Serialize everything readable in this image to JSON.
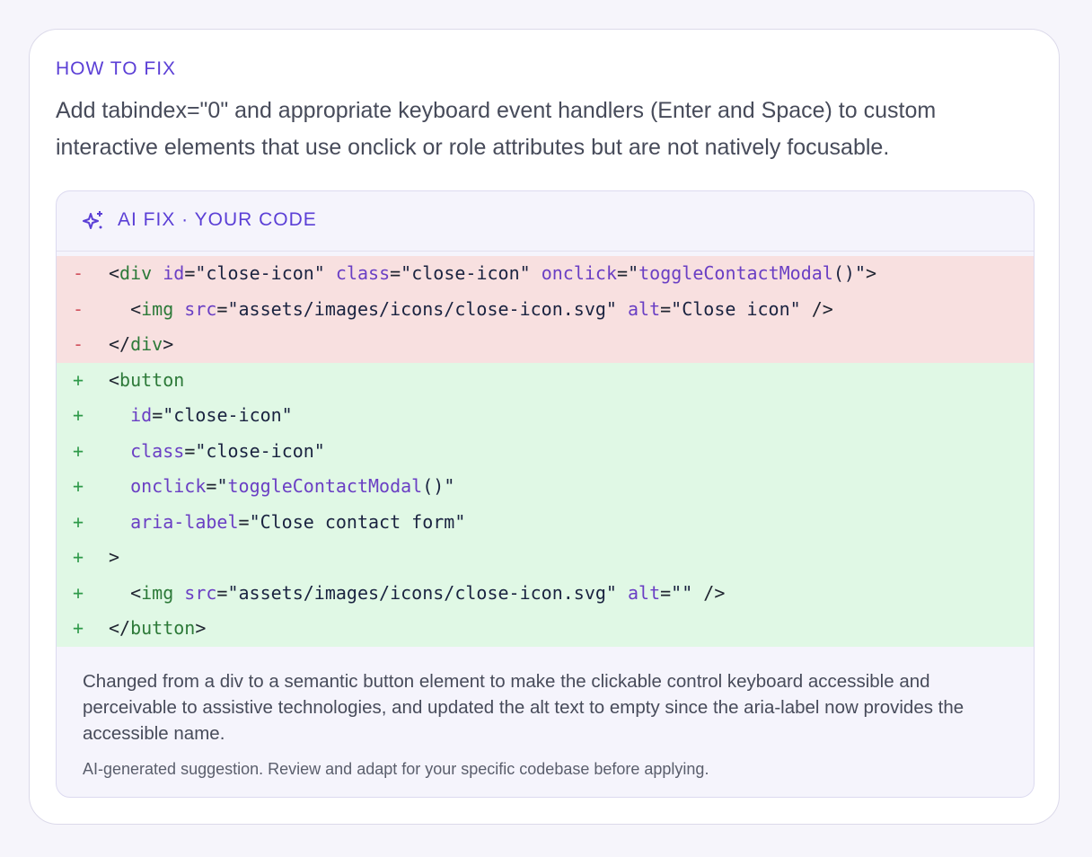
{
  "how_to_fix": {
    "title": "HOW TO FIX",
    "description": "Add tabindex=\"0\" and appropriate keyboard event handlers (Enter and Space) to custom interactive elements that use onclick or role attributes but are not natively focusable."
  },
  "ai_fix": {
    "label": "AI FIX · YOUR CODE",
    "icon": "sparkles-icon",
    "diff_lines": [
      {
        "type": "del",
        "marker": "-",
        "tokens": [
          [
            "p",
            "<"
          ],
          [
            "t",
            "div"
          ],
          [
            "p",
            " "
          ],
          [
            "a",
            "id"
          ],
          [
            "p",
            "="
          ],
          [
            "s",
            "\"close-icon\""
          ],
          [
            "p",
            " "
          ],
          [
            "a",
            "class"
          ],
          [
            "p",
            "="
          ],
          [
            "s",
            "\"close-icon\""
          ],
          [
            "p",
            " "
          ],
          [
            "a",
            "onclick"
          ],
          [
            "p",
            "="
          ],
          [
            "s",
            "\""
          ],
          [
            "a",
            "toggleContactModal"
          ],
          [
            "s",
            "()\""
          ],
          [
            "p",
            ">"
          ]
        ]
      },
      {
        "type": "del",
        "marker": "-",
        "tokens": [
          [
            "p",
            "  <"
          ],
          [
            "t",
            "img"
          ],
          [
            "p",
            " "
          ],
          [
            "a",
            "src"
          ],
          [
            "p",
            "="
          ],
          [
            "s",
            "\"assets/images/icons/close-icon.svg\""
          ],
          [
            "p",
            " "
          ],
          [
            "a",
            "alt"
          ],
          [
            "p",
            "="
          ],
          [
            "s",
            "\"Close icon\""
          ],
          [
            "p",
            " />"
          ]
        ]
      },
      {
        "type": "del",
        "marker": "-",
        "tokens": [
          [
            "p",
            "</"
          ],
          [
            "t",
            "div"
          ],
          [
            "p",
            ">"
          ]
        ]
      },
      {
        "type": "add",
        "marker": "+",
        "tokens": [
          [
            "p",
            "<"
          ],
          [
            "t",
            "button"
          ]
        ]
      },
      {
        "type": "add",
        "marker": "+",
        "tokens": [
          [
            "p",
            "  "
          ],
          [
            "a",
            "id"
          ],
          [
            "p",
            "="
          ],
          [
            "s",
            "\"close-icon\""
          ]
        ]
      },
      {
        "type": "add",
        "marker": "+",
        "tokens": [
          [
            "p",
            "  "
          ],
          [
            "a",
            "class"
          ],
          [
            "p",
            "="
          ],
          [
            "s",
            "\"close-icon\""
          ]
        ]
      },
      {
        "type": "add",
        "marker": "+",
        "tokens": [
          [
            "p",
            "  "
          ],
          [
            "a",
            "onclick"
          ],
          [
            "p",
            "="
          ],
          [
            "s",
            "\""
          ],
          [
            "a",
            "toggleContactModal"
          ],
          [
            "s",
            "()\""
          ]
        ]
      },
      {
        "type": "add",
        "marker": "+",
        "tokens": [
          [
            "p",
            "  "
          ],
          [
            "a",
            "aria-label"
          ],
          [
            "p",
            "="
          ],
          [
            "s",
            "\"Close contact form\""
          ]
        ]
      },
      {
        "type": "add",
        "marker": "+",
        "tokens": [
          [
            "p",
            ">"
          ]
        ]
      },
      {
        "type": "add",
        "marker": "+",
        "tokens": [
          [
            "p",
            "  <"
          ],
          [
            "t",
            "img"
          ],
          [
            "p",
            " "
          ],
          [
            "a",
            "src"
          ],
          [
            "p",
            "="
          ],
          [
            "s",
            "\"assets/images/icons/close-icon.svg\""
          ],
          [
            "p",
            " "
          ],
          [
            "a",
            "alt"
          ],
          [
            "p",
            "="
          ],
          [
            "s",
            "\"\""
          ],
          [
            "p",
            " />"
          ]
        ]
      },
      {
        "type": "add",
        "marker": "+",
        "tokens": [
          [
            "p",
            "</"
          ],
          [
            "t",
            "button"
          ],
          [
            "p",
            ">"
          ]
        ]
      }
    ],
    "explanation": "Changed from a div to a semantic button element to make the clickable control keyboard accessible and perceivable to assistive technologies, and updated the alt text to empty since the aria-label now provides the accessible name.",
    "disclaimer": "AI-generated suggestion. Review and adapt for your specific codebase before applying."
  },
  "colors": {
    "accent": "#5b3fd6",
    "deleted_bg": "#f8e0e0",
    "added_bg": "#e0f8e5"
  }
}
